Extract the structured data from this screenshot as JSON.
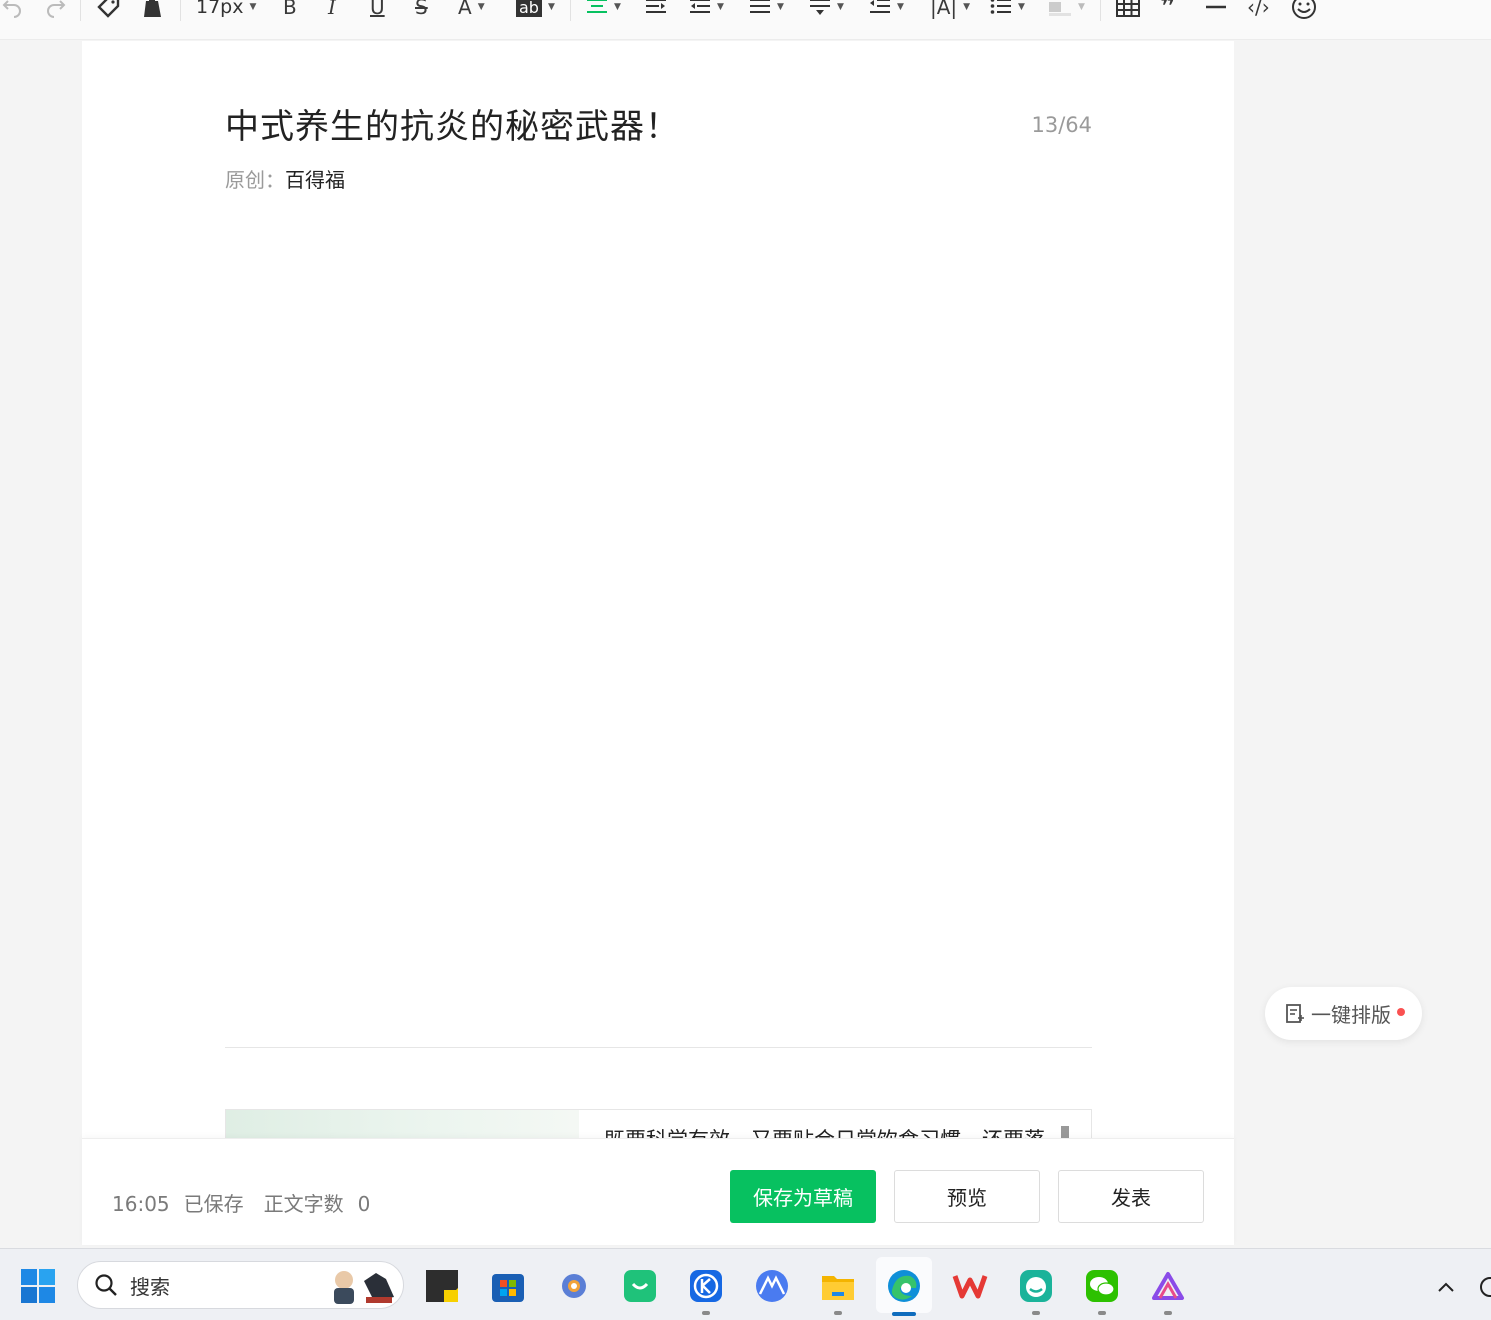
{
  "toolbar": {
    "font_size": "17px",
    "icons": [
      "undo-icon",
      "redo-icon",
      "format-brush-icon",
      "clear-format-icon",
      "bold-icon",
      "italic-icon",
      "underline-icon",
      "strikethrough-icon",
      "font-color-icon",
      "highlight-icon",
      "align-center-icon",
      "indent-icon",
      "outdent-icon",
      "line-height-icon",
      "paragraph-spacing-icon",
      "list-indent-icon",
      "letter-spacing-icon",
      "bullet-list-icon",
      "background-color-icon",
      "table-icon",
      "quote-icon",
      "divider-icon",
      "code-icon",
      "emoji-icon"
    ],
    "glyphs": {
      "bold": "B",
      "italic": "I",
      "underline": "U",
      "strikethrough": "S",
      "font_color": "A",
      "highlight": "ab",
      "quote": "❞",
      "code": "‹/›",
      "letter_spacing": "|A|"
    },
    "accent": "#07c160"
  },
  "editor": {
    "title": "中式养生的抗炎的秘密武器！",
    "title_count": "13/64",
    "author_label": "原创：",
    "author_name": "百得福",
    "card_text": "既要科学有效，又要贴合日常饮食习惯，还要落"
  },
  "actionbar": {
    "time": "16:05",
    "save_state": "已保存",
    "word_count_label": "正文字数",
    "word_count": "0",
    "draft_label": "保存为草稿",
    "preview_label": "预览",
    "publish_label": "发表",
    "primary_color": "#07c160"
  },
  "float": {
    "label": "一键排版",
    "dot_color": "#fa5151"
  },
  "taskbar": {
    "search_placeholder": "搜索",
    "apps": [
      "start-icon",
      "search-icon",
      "sticky-notes-icon",
      "microsoft-store-icon",
      "settings-gear-icon",
      "green-bag-app-icon",
      "k-app-icon",
      "mountain-app-icon",
      "file-explorer-icon",
      "edge-browser-icon",
      "wps-office-icon",
      "green-face-app-icon",
      "wechat-icon",
      "prism-app-icon",
      "chevron-up-icon"
    ]
  }
}
